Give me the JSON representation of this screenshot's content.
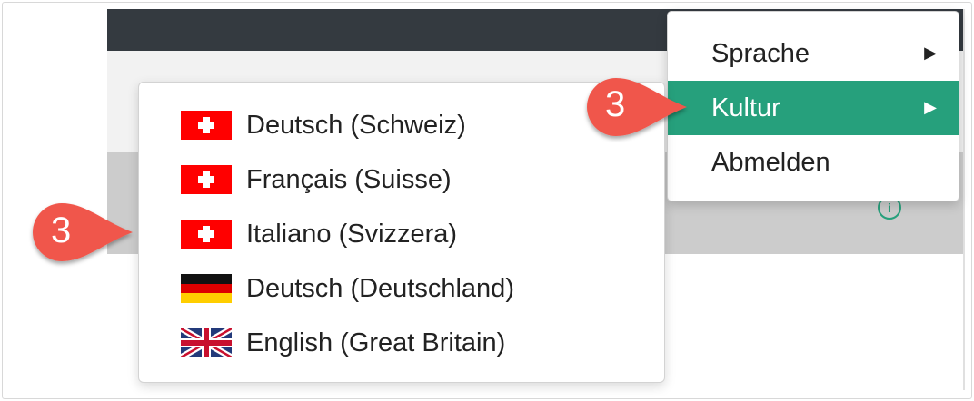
{
  "user_menu": {
    "items": [
      {
        "label": "Sprache",
        "submenu_arrow": "▶"
      },
      {
        "label": "Kultur",
        "submenu_arrow": "▶"
      },
      {
        "label": "Abmelden"
      }
    ],
    "active_label": "Kultur",
    "accent_color": "#26a07c"
  },
  "culture_menu": {
    "items": [
      {
        "label": "Deutsch (Schweiz)",
        "flag": "swiss-flag-icon"
      },
      {
        "label": "Français (Suisse)",
        "flag": "swiss-flag-icon"
      },
      {
        "label": "Italiano (Svizzera)",
        "flag": "swiss-flag-icon"
      },
      {
        "label": "Deutsch (Deutschland)",
        "flag": "german-flag-icon"
      },
      {
        "label": "English (Great Britain)",
        "flag": "uk-flag-icon"
      }
    ]
  },
  "callouts": [
    {
      "number": "3"
    },
    {
      "number": "3"
    }
  ],
  "colors": {
    "topbar": "#343a40",
    "callout": "#f0574b",
    "swiss_red": "#ff0000"
  }
}
